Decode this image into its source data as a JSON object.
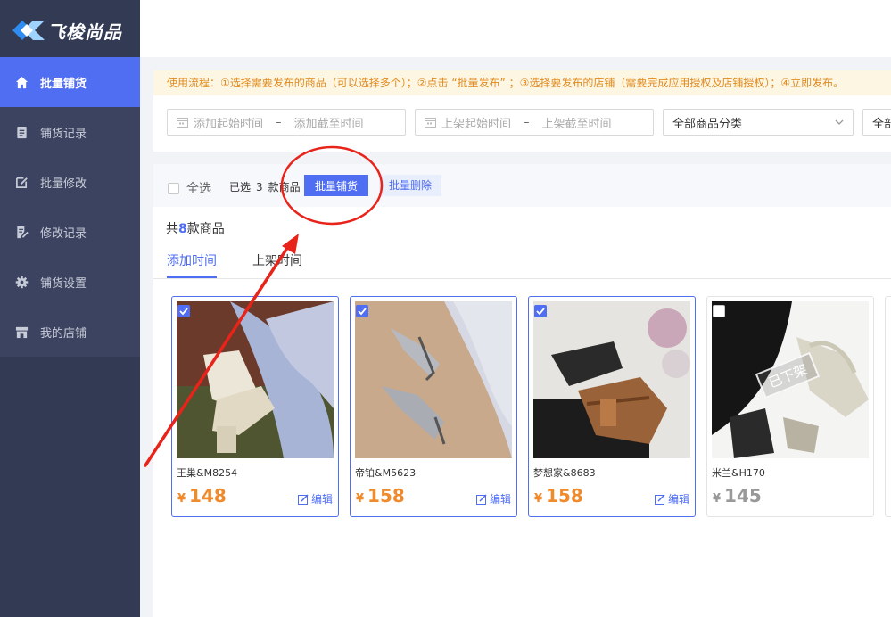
{
  "brand": {
    "name": "飞梭尚品"
  },
  "sidebar": {
    "items": [
      {
        "label": "批量铺货",
        "icon": "home-icon",
        "active": true
      },
      {
        "label": "铺货记录",
        "icon": "document-icon",
        "active": false
      },
      {
        "label": "批量修改",
        "icon": "edit-box-icon",
        "active": false
      },
      {
        "label": "修改记录",
        "icon": "edit-document-icon",
        "active": false
      },
      {
        "label": "铺货设置",
        "icon": "gear-icon",
        "active": false
      },
      {
        "label": "我的店铺",
        "icon": "store-icon",
        "active": false
      }
    ]
  },
  "notice": "使用流程：①选择需要发布的商品（可以选择多个）；②点击 “批量发布” ；③选择要发布的店铺（需要完成应用授权及店铺授权）；④立即发布。",
  "filters": {
    "add_start": "添加起始时间",
    "add_end": "添加截至时间",
    "shelf_start": "上架起始时间",
    "shelf_end": "上架截至时间",
    "dash": "–",
    "category": "全部商品分类",
    "extra": "全部"
  },
  "bulk": {
    "select_all": "全选",
    "selected_prefix": "已选",
    "selected_count": "3",
    "selected_suffix": "款商品",
    "bulk_publish": "批量铺货",
    "bulk_delete": "批量删除"
  },
  "total": {
    "prefix": "共",
    "count": "8",
    "suffix": "款商品"
  },
  "tabs": [
    {
      "label": "添加时间",
      "active": true
    },
    {
      "label": "上架时间",
      "active": false
    }
  ],
  "products": [
    {
      "name": "王巢&M8254",
      "currency": "¥",
      "price": "148",
      "selected": true,
      "edit": "编辑",
      "status": ""
    },
    {
      "name": "帝铂&M5623",
      "currency": "¥",
      "price": "158",
      "selected": true,
      "edit": "编辑",
      "status": ""
    },
    {
      "name": "梦想家&8683",
      "currency": "¥",
      "price": "158",
      "selected": true,
      "edit": "编辑",
      "status": ""
    },
    {
      "name": "米兰&H170",
      "currency": "¥",
      "price": "145",
      "selected": false,
      "edit": "",
      "status": "已下架"
    }
  ],
  "colors": {
    "accent": "#4f6ef2",
    "sidebar": "#333a54",
    "price": "#ef8b2c",
    "notice": "#e08a1e",
    "annotation": "#e8231a"
  }
}
